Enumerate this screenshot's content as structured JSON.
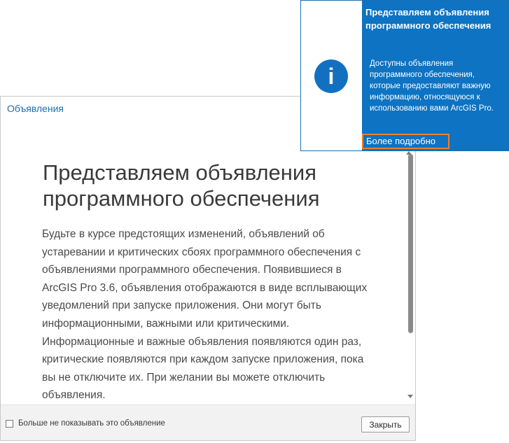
{
  "dialog": {
    "title": "Объявления",
    "heading": "Представляем объявления программного обеспечения",
    "body": "Будьте в курсе предстоящих изменений, объявлений об устаревании и критических сбоях программного обеспечения с объявлениями программного обеспечения. Появившиеся в ArcGIS Pro 3.6, объявления отображаются в виде всплывающих уведомлений при запуске приложения. Они могут быть информационными, важными или критическими. Информационные и важные объявления появляются один раз, критические появляются при каждом запуске приложения, пока вы не отключите их. При желании вы можете отключить объявления.",
    "checkbox_label": "Больше не показывать это объявление",
    "checkbox_checked": false,
    "close_label": "Закрыть"
  },
  "toast": {
    "icon": "info-icon",
    "icon_glyph": "i",
    "title": "Представляем объявления программного обеспечения",
    "text": "Доступны объявления программного обеспечения, которые предоставляют важную информацию, относящуюся к использованию вами ArcGIS Pro.",
    "link_label": "Более подробно"
  },
  "colors": {
    "toast_background": "#0d73c2",
    "info_icon": "#1370c0",
    "link_focus_border": "#f07f2a",
    "dialog_title": "#1a6fb0"
  }
}
